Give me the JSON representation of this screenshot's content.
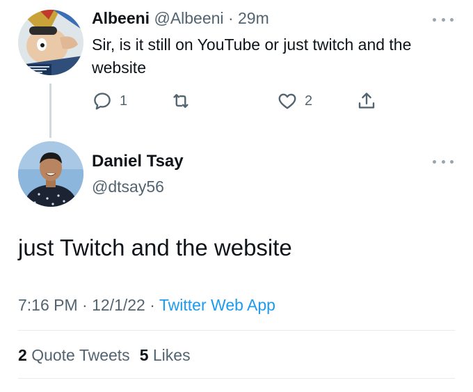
{
  "reply": {
    "author_name": "Albeeni",
    "handle": "@Albeeni",
    "separator": "·",
    "time": "29m",
    "text": "Sir, is it still on YouTube or just twitch and the website",
    "reply_count": "1",
    "like_count": "2",
    "avatar_icon": "cartoon-character-avatar"
  },
  "tweet": {
    "author_name": "Daniel Tsay",
    "handle": "@dtsay56",
    "text": "just Twitch and the website",
    "time": "7:16 PM",
    "date": "12/1/22",
    "separator": "·",
    "source": "Twitter Web App",
    "quote_count": "2",
    "quote_label": "Quote Tweets",
    "like_count": "5",
    "like_label": "Likes",
    "avatar_icon": "profile-photo-avatar"
  },
  "colors": {
    "text_primary": "#0f1419",
    "text_secondary": "#536471",
    "link": "#1d9bf0",
    "divider": "#e6ecf0",
    "thread_line": "#cfd9de"
  }
}
